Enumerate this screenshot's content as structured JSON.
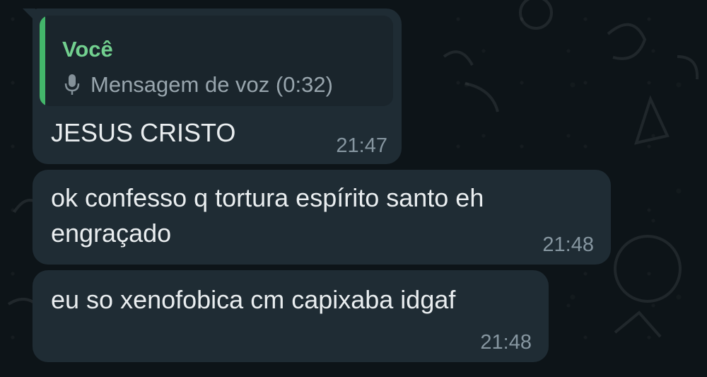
{
  "messages": [
    {
      "quoted": {
        "author": "Você",
        "icon": "mic-icon",
        "text": "Mensagem de voz (0:32)"
      },
      "text": "JESUS CRISTO",
      "time": "21:47"
    },
    {
      "line1": "ok confesso q tortura espírito santo eh",
      "line2": "engraçado",
      "time": "21:48"
    },
    {
      "text": "eu so xenofobica cm capixaba idgaf",
      "time": "21:48"
    }
  ],
  "colors": {
    "background": "#0b141a",
    "bubble": "#1f2c34",
    "quote_bar": "#43b66a",
    "quote_name": "#72d08f",
    "meta": "#8696a0"
  }
}
